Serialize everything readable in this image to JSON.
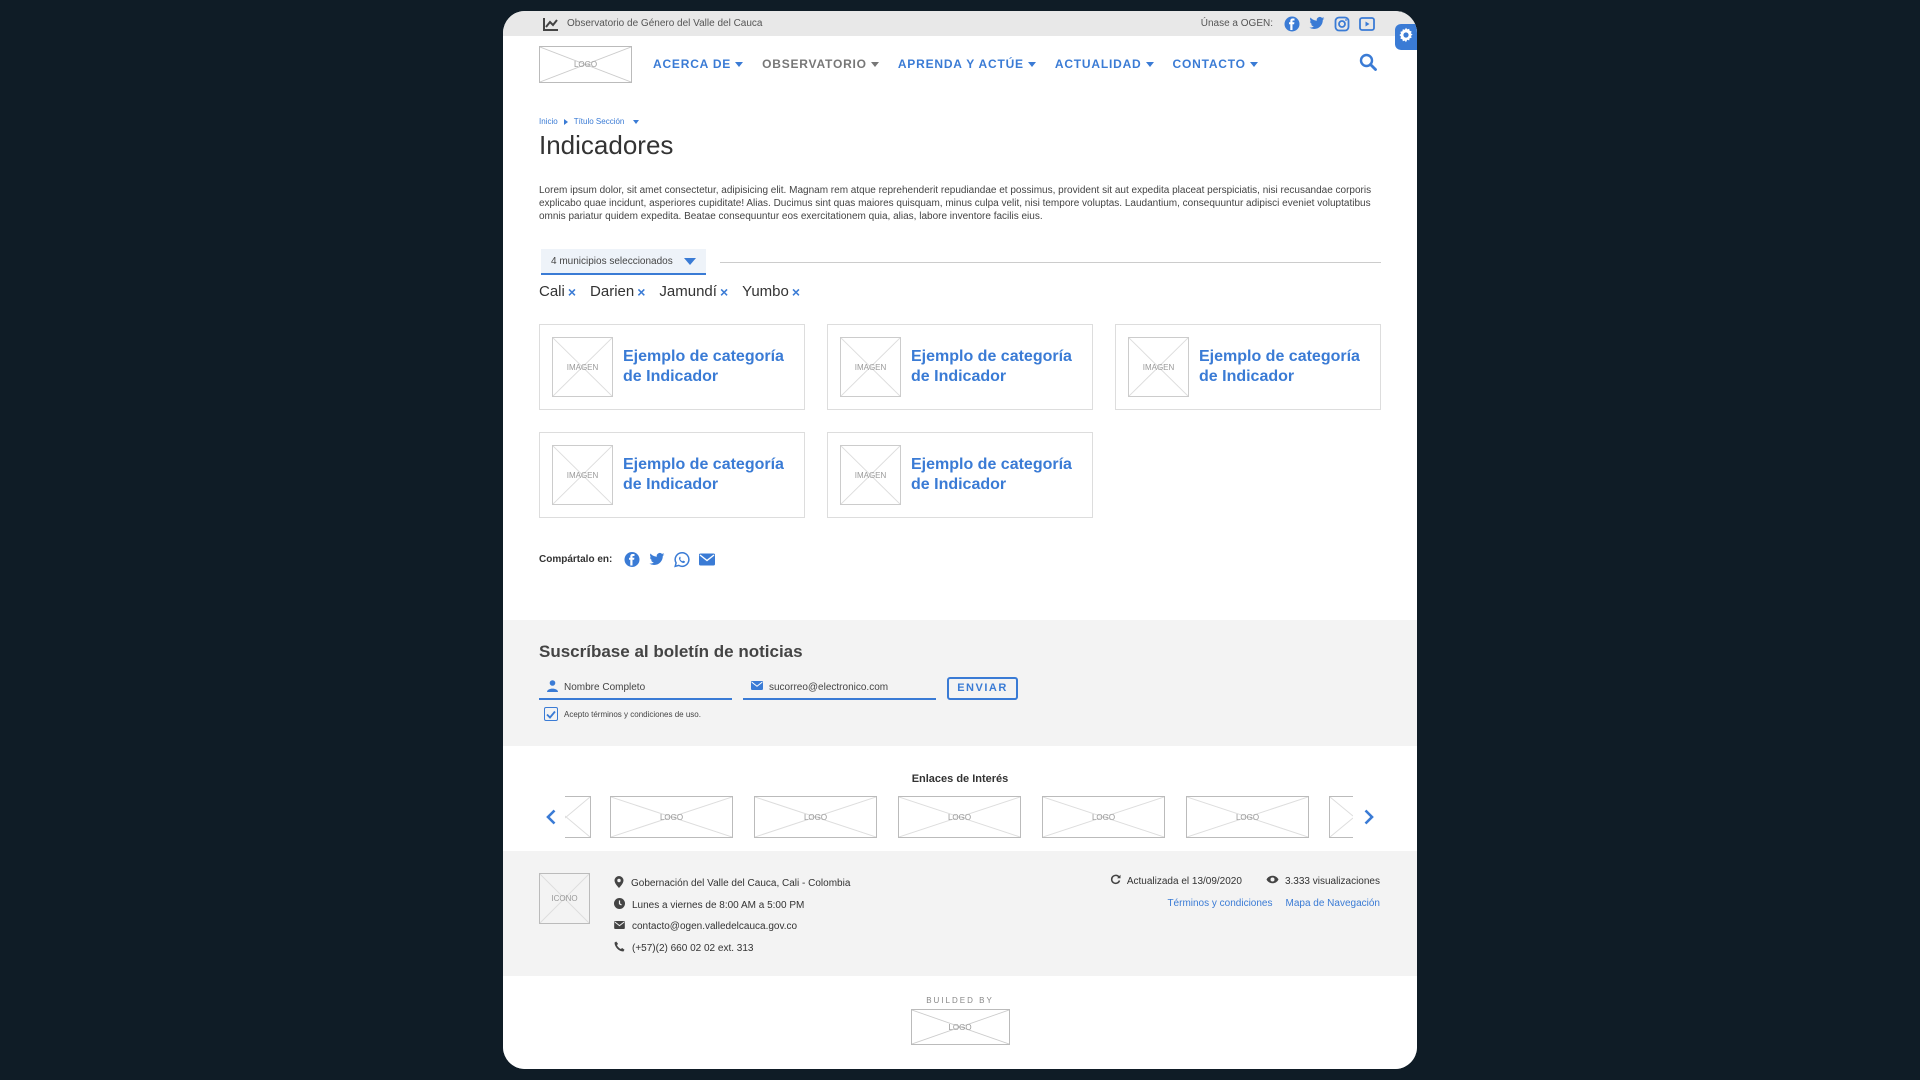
{
  "topbar": {
    "site_name": "Observatorio de Género del Valle del Cauca",
    "join_label": "Únase a OGEN:"
  },
  "header": {
    "logo_text": "LOGO",
    "nav": [
      {
        "label": "ACERCA DE"
      },
      {
        "label": "OBSERVATORIO"
      },
      {
        "label": "APRENDA Y ACTÚE"
      },
      {
        "label": "ACTUALIDAD"
      },
      {
        "label": "CONTACTO"
      }
    ]
  },
  "breadcrumb": {
    "home": "Inicio",
    "section": "Título Sección"
  },
  "page": {
    "title": "Indicadores",
    "intro": "Lorem ipsum dolor, sit amet consectetur, adipisicing elit. Magnam rem atque reprehenderit repudiandae et possimus, provident sit aut expedita placeat perspiciatis, nisi recusandae corporis explicabo quae incidunt, asperiores cupiditate! Alias. Ducimus sint quas maiores quisquam, minus culpa velit, nisi tempore voluptas. Laudantium, consequuntur adipisci eveniet voluptatibus omnis pariatur quidem expedita. Beatae consequuntur eos exercitationem quia, alias, labore inventore facilis eius."
  },
  "filter": {
    "selected_label": "4 municipios seleccionados",
    "chips": [
      "Cali",
      "Darien",
      "Jamundí",
      "Yumbo"
    ],
    "remove_glyph": "×"
  },
  "cards": [
    {
      "image": "IMAGEN",
      "title": "Ejemplo de categoría de Indicador"
    },
    {
      "image": "IMAGEN",
      "title": "Ejemplo de categoría de Indicador"
    },
    {
      "image": "IMAGEN",
      "title": "Ejemplo de categoría de Indicador"
    },
    {
      "image": "IMAGEN",
      "title": "Ejemplo de categoría de Indicador"
    },
    {
      "image": "IMAGEN",
      "title": "Ejemplo de categoría de Indicador"
    }
  ],
  "share": {
    "label": "Compártalo en:"
  },
  "newsletter": {
    "title": "Suscríbase al boletín de noticias",
    "name_placeholder": "Nombre Completo",
    "email_placeholder": "sucorreo@electronico.com",
    "submit_label": "ENVIAR",
    "terms_label": "Acepto términos y condiciones de uso.",
    "terms_checked": true
  },
  "links": {
    "title": "Enlaces de Interés",
    "logos": [
      "LOGO",
      "LOGO",
      "LOGO",
      "LOGO",
      "LOGO"
    ]
  },
  "footer": {
    "icon_text": "ICONO",
    "address": "Gobernación del Valle del Cauca, Cali - Colombia",
    "hours": "Lunes a viernes de 8:00 AM a 5:00 PM",
    "email": "contacto@ogen.valledelcauca.gov.co",
    "phone": "(+57)(2) 660 02 02 ext. 313",
    "updated": "Actualizada el 13/09/2020",
    "views": "3.333 visualizaciones",
    "terms_link": "Términos y condiciones",
    "sitemap_link": "Mapa de Navegación"
  },
  "builded": {
    "label": "BUILDED BY",
    "logo_text": "LOGO"
  },
  "colors": {
    "accent": "#3a7bd5",
    "page_bg": "#0f1c26",
    "panel_bg": "#f3f3f3"
  }
}
